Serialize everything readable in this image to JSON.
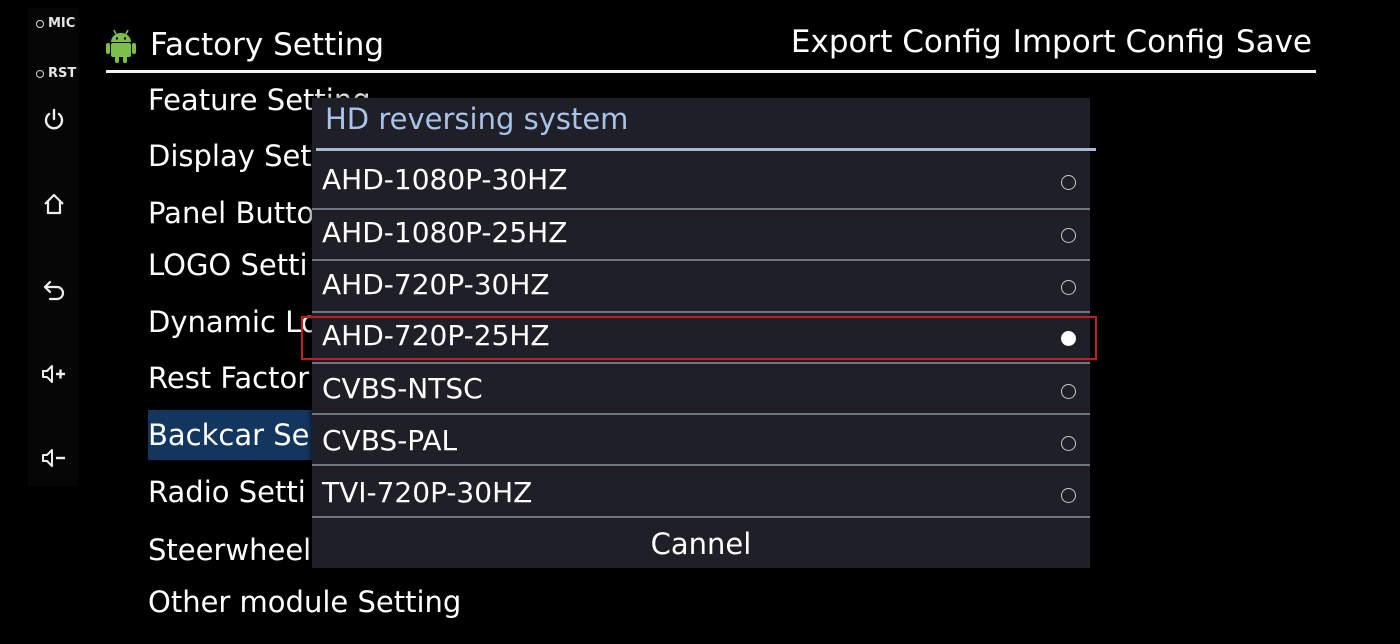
{
  "hardware_strip": {
    "mic_label": "MIC",
    "rst_label": "RST",
    "icons": [
      "power-icon",
      "home-icon",
      "back-icon",
      "volume-up-icon",
      "volume-down-icon"
    ]
  },
  "header": {
    "app_icon": "android-icon",
    "title": "Factory Setting",
    "actions": {
      "export": "Export Config",
      "import": "Import Config",
      "save": "Save"
    }
  },
  "menu": {
    "items": [
      {
        "label": "Feature Setting"
      },
      {
        "label": "Display Setting"
      },
      {
        "label": "Panel Button Setting"
      },
      {
        "label": "LOGO Setting"
      },
      {
        "label": "Dynamic LOGO Setting"
      },
      {
        "label": "Rest Factory Setting"
      },
      {
        "label": "Backcar Setting"
      },
      {
        "label": "Radio Setting"
      },
      {
        "label": "Steerwheel Setting"
      },
      {
        "label": "Other module Setting"
      }
    ],
    "visible_labels": [
      "Feature Setting",
      "Display Set",
      "Panel Butto",
      "LOGO Setti",
      "Dynamic Lo",
      "Rest Factor",
      "Backcar Se",
      "Radio Setti",
      "Steerwheel",
      "Other module Setting"
    ],
    "selected_index": 6
  },
  "dialog": {
    "title": "HD reversing system",
    "options": [
      {
        "label": "AHD-1080P-30HZ",
        "checked": false
      },
      {
        "label": "AHD-1080P-25HZ",
        "checked": false
      },
      {
        "label": "AHD-720P-30HZ",
        "checked": false
      },
      {
        "label": "AHD-720P-25HZ",
        "checked": true
      },
      {
        "label": "CVBS-NTSC",
        "checked": false
      },
      {
        "label": "CVBS-PAL",
        "checked": false
      },
      {
        "label": "TVI-720P-30HZ",
        "checked": false
      }
    ],
    "focused_index": 3,
    "cancel_label": "Cannel"
  },
  "colors": {
    "background": "#000000",
    "dialog_bg": "#1f1f28",
    "dialog_title": "#a8c2e8",
    "selected_menu_bg": "#12365e",
    "focus_border": "#c01c22",
    "android_green": "#7cc04a"
  }
}
